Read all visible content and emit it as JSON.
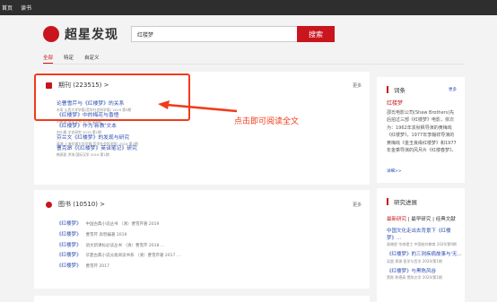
{
  "topbar": {
    "items": [
      "首页",
      "读书"
    ]
  },
  "logo": {
    "text": "超星发现"
  },
  "search": {
    "value": "红楼梦",
    "button": "搜索"
  },
  "tabs": [
    "全部",
    "特定",
    "自定义"
  ],
  "journals": {
    "title": "期刊 (223515) >",
    "more": "更多",
    "items": [
      {
        "title": "论曹雪芹与《红楼梦》的关系",
        "meta": "木寿 山西大学学报(哲学社会科学版) 2019 第3期"
      },
      {
        "title": "《红楼梦》中的梅花与香悟",
        "meta": "刘彦萱 求是学刊 2019 第6期"
      },
      {
        "title": "《红楼梦》作为'新教'文本",
        "meta": "刘小枫 文艺研究 2019 第1期"
      },
      {
        "title": "芬兰文《红楼梦》的发现与研究",
        "meta": "高源 上海交通大学学报(哲学社会科学版) 2019 第2期"
      },
      {
        "title": "曹克昂《《红楼梦》英译笔记》研究",
        "meta": "韩雨凯 洪涛 国际汉学 2019 第1期"
      }
    ]
  },
  "books": {
    "title": "图书 (10510) >",
    "more": "更多",
    "items": [
      {
        "title": "《红楼梦》",
        "meta": "中国古典小说丛书 （清）曹雪芹著 2019"
      },
      {
        "title": "《红楼梦》",
        "meta": "曹雪芹 高鹗编著 2019"
      },
      {
        "title": "《红楼梦》",
        "meta": "语文新课标必读丛书 （清）曹雪芹 2018 ..."
      },
      {
        "title": "《红楼梦》",
        "meta": "华夏古典小说分类阅读书系 （清）曹雪芹著 2017 ..."
      },
      {
        "title": "《红楼梦》",
        "meta": "曹雪芹 2017"
      }
    ]
  },
  "annotation": "点击即可阅读全文",
  "sidebar": {
    "entry_title": "词条",
    "entry_more": "更多",
    "term": "红楼梦",
    "desc": "邵氏电影公司(Shaw Brothers)先后拍过三部《红楼梦》电影，依次为：1962年袁秋枫导演的黄梅戏《红楼梦》，1977年李翰祥导演的黄梅戏《金玉良缘红楼梦》和1977年金乘导演的风月片《红楼春梦》。",
    "detail": "详细>>",
    "research_title": "研究进展",
    "research_tabs": [
      "最新研究",
      "最早研究",
      "经典文献"
    ],
    "research_sep": "|",
    "research_items": [
      {
        "title": "中国文化走出去背景下《红楼梦》...",
        "meta": "袁晓舒 华南理工 中国校外教育 2020/第9期"
      },
      {
        "title": "《红楼梦》的三则疾病故事与'无...",
        "meta": "吴超 郑源 医学与哲学 2020/第1期"
      },
      {
        "title": "《红楼梦》与黑陈风谷",
        "meta": "黑陈 陈德高 黑陈文学 2020/第1期"
      }
    ]
  },
  "colors": {
    "brand_red": "#c9151e",
    "annotation_red": "#f13b1a",
    "link_blue": "#2a4bb0",
    "topbar_bg": "#2e2e2e"
  }
}
